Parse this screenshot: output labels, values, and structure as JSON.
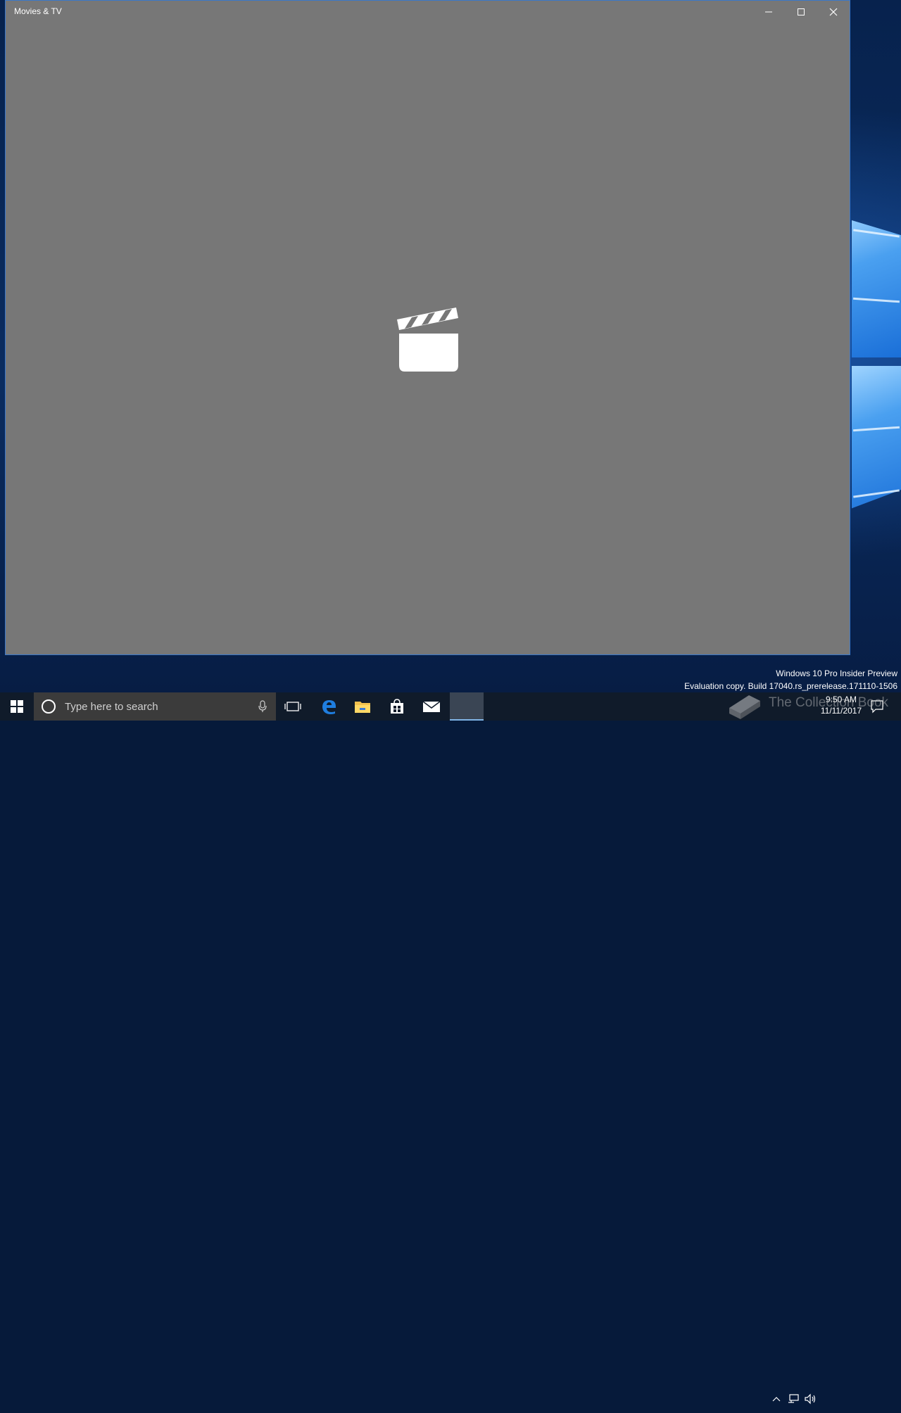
{
  "window": {
    "title": "Movies & TV",
    "controls": {
      "minimize": "minimize-icon",
      "maximize": "maximize-icon",
      "close": "close-icon"
    }
  },
  "splash": {
    "icon": "clapperboard-icon"
  },
  "desktop": {
    "watermark_line1": "Windows 10 Pro Insider Preview",
    "watermark_line2": "Evaluation copy. Build 17040.rs_prerelease.171110-1506"
  },
  "taskbar": {
    "search_placeholder": "Type here to search",
    "pinned_apps": [
      "start",
      "task-view",
      "edge",
      "file-explorer",
      "store",
      "mail",
      "movies-tv"
    ],
    "clock_time": "9:50 AM",
    "clock_date": "11/11/2017"
  },
  "overlay_watermark": "The Collection Book",
  "colors": {
    "window_bg": "#777777",
    "window_border": "#3b78c9",
    "taskbar_bg": "#101b2a",
    "search_bg": "#3b3b3b"
  }
}
